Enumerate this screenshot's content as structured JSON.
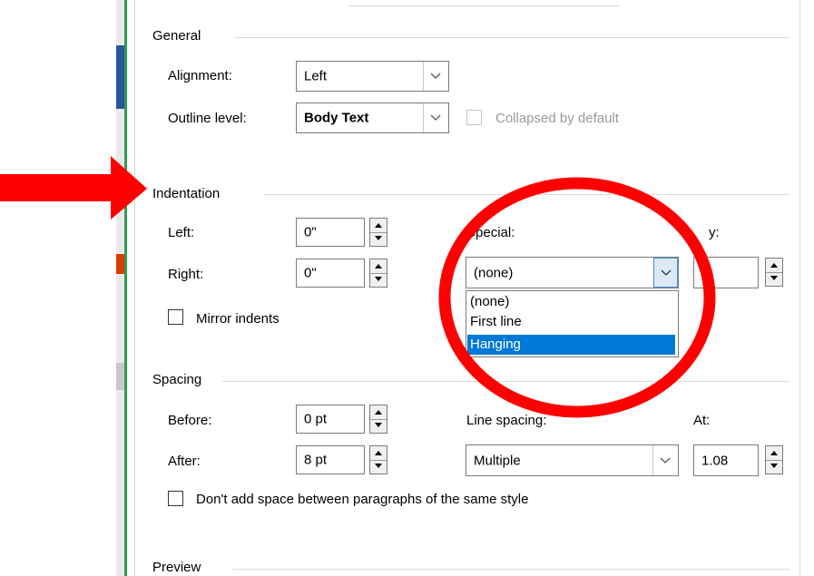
{
  "general": {
    "heading": "General",
    "alignment_label": "Alignment:",
    "alignment_value": "Left",
    "outline_label": "Outline level:",
    "outline_value": "Body Text",
    "collapsed_label": "Collapsed by default"
  },
  "indentation": {
    "heading": "Indentation",
    "left_label": "Left:",
    "left_value": "0\"",
    "right_label": "Right:",
    "right_value": "0\"",
    "special_label": "Special:",
    "special_value": "(none)",
    "by_label_partial": "y:",
    "mirror_label": "Mirror indents",
    "special_options": [
      "(none)",
      "First line",
      "Hanging"
    ],
    "special_highlighted": "Hanging"
  },
  "spacing": {
    "heading": "Spacing",
    "before_label": "Before:",
    "before_value": "0 pt",
    "after_label": "After:",
    "after_value": "8 pt",
    "line_spacing_label": "Line spacing:",
    "line_spacing_value": "Multiple",
    "at_label": "At:",
    "at_value": "1.08",
    "dont_add_label": "Don't add space between paragraphs of the same style"
  },
  "preview": {
    "heading": "Preview"
  },
  "colors": {
    "annotation_red": "#ff0000",
    "selection_blue": "#0078d7",
    "left_edge_green": "#2e9e4f"
  }
}
